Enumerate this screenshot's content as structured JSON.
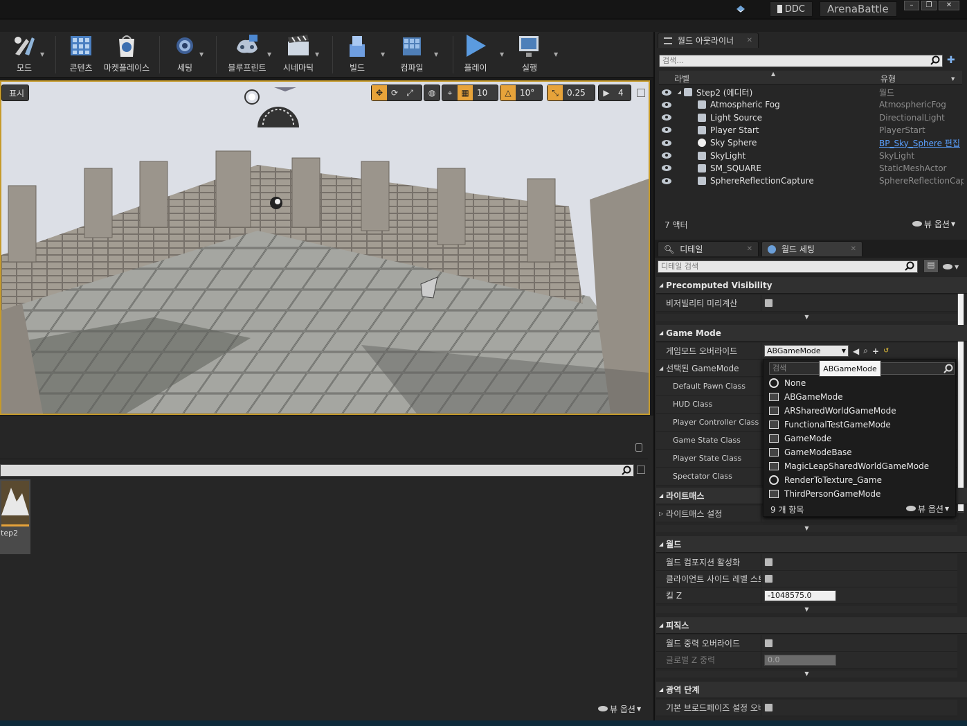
{
  "titlebar": {
    "ddc_label": "DDC",
    "project_name": "ArenaBattle",
    "win_buttons": [
      "–",
      "❐",
      "✕"
    ]
  },
  "toolbar": {
    "items": [
      {
        "label": "모드",
        "icon": "modes-icon"
      },
      {
        "label": "콘텐츠",
        "icon": "content-icon"
      },
      {
        "label": "마켓플레이스",
        "icon": "marketplace-icon"
      },
      {
        "label": "세팅",
        "icon": "settings-icon"
      },
      {
        "label": "블루프린트",
        "icon": "blueprint-icon"
      },
      {
        "label": "시네마틱",
        "icon": "cinematics-icon"
      },
      {
        "label": "빌드",
        "icon": "build-icon"
      },
      {
        "label": "컴파일",
        "icon": "compile-icon"
      },
      {
        "label": "플레이",
        "icon": "play-icon"
      },
      {
        "label": "실행",
        "icon": "launch-icon"
      }
    ]
  },
  "viewport": {
    "show_label": "표시",
    "grid_snap": "10",
    "rotation_snap": "10°",
    "scale_snap": "0.25",
    "camera_speed": "4"
  },
  "content_browser": {
    "asset_label": "tep2",
    "view_options": "뷰 옵션"
  },
  "outliner": {
    "tab_title": "월드 아웃라이너",
    "search_placeholder": "검색...",
    "col_label": "라벨",
    "col_type": "유형",
    "rows": [
      {
        "label": "Step2 (에디터)",
        "type": "월드",
        "indent": 0
      },
      {
        "label": "Atmospheric Fog",
        "type": "AtmosphericFog",
        "indent": 1
      },
      {
        "label": "Light Source",
        "type": "DirectionalLight",
        "indent": 1
      },
      {
        "label": "Player Start",
        "type": "PlayerStart",
        "indent": 1
      },
      {
        "label": "Sky Sphere",
        "type": "BP_Sky_Sphere 편집",
        "indent": 1,
        "link": true
      },
      {
        "label": "SkyLight",
        "type": "SkyLight",
        "indent": 1
      },
      {
        "label": "SM_SQUARE",
        "type": "StaticMeshActor",
        "indent": 1
      },
      {
        "label": "SphereReflectionCapture",
        "type": "SphereReflectionCaptu",
        "indent": 1
      }
    ],
    "actor_count": "7 액터",
    "view_options": "뷰 옵션"
  },
  "details": {
    "tab_details": "디테일",
    "tab_world_settings": "월드 세팅",
    "search_placeholder": "디테일 검색",
    "categories": {
      "precomputed": "Precomputed Visibility",
      "game_mode": "Game Mode",
      "lightmass": "라이트매스",
      "world": "월드",
      "physics": "피직스",
      "broadphase": "광역 단계"
    },
    "props": {
      "precompute_visibility": "비저빌리티 미리계산",
      "gamemode_override": "게임모드 오버라이드",
      "selected_gamemode": "선택된 GameMode",
      "default_pawn": "Default Pawn Class",
      "hud": "HUD Class",
      "player_controller": "Player Controller Class",
      "game_state": "Game State Class",
      "player_state": "Player State Class",
      "spectator": "Spectator Class",
      "lightmass_settings": "라이트매스 설정",
      "world_composition": "월드 컴포지션 활성화",
      "client_side_level": "클라이언트 사이드 레벨 스트리",
      "kill_z": "킬 Z",
      "kill_z_value": "-1048575.0",
      "world_gravity_override": "월드 중력 오버라이드",
      "global_gravity_z": "글로벌 Z 중력",
      "global_gravity_z_value": "0.0",
      "broadphase_override": "기본 브로드페이즈 설정 오버라"
    },
    "gamemode_combo_value": "ABGameMode"
  },
  "dropdown": {
    "search_placeholder": "검색",
    "tooltip": "ABGameMode",
    "items": [
      {
        "label": "None",
        "icon": "circle"
      },
      {
        "label": "ABGameMode",
        "icon": "class"
      },
      {
        "label": "ARSharedWorldGameMode",
        "icon": "class"
      },
      {
        "label": "FunctionalTestGameMode",
        "icon": "class"
      },
      {
        "label": "GameMode",
        "icon": "class"
      },
      {
        "label": "GameModeBase",
        "icon": "class"
      },
      {
        "label": "MagicLeapSharedWorldGameMode",
        "icon": "class"
      },
      {
        "label": "RenderToTexture_Game",
        "icon": "circle"
      },
      {
        "label": "ThirdPersonGameMode",
        "icon": "class"
      }
    ],
    "count": "9 개 항목",
    "view_options": "뷰 옵션"
  },
  "colors": {
    "viewport_border": "#c69a2a",
    "link": "#5aa0ff",
    "selection_yellow": "#e7b33a"
  }
}
